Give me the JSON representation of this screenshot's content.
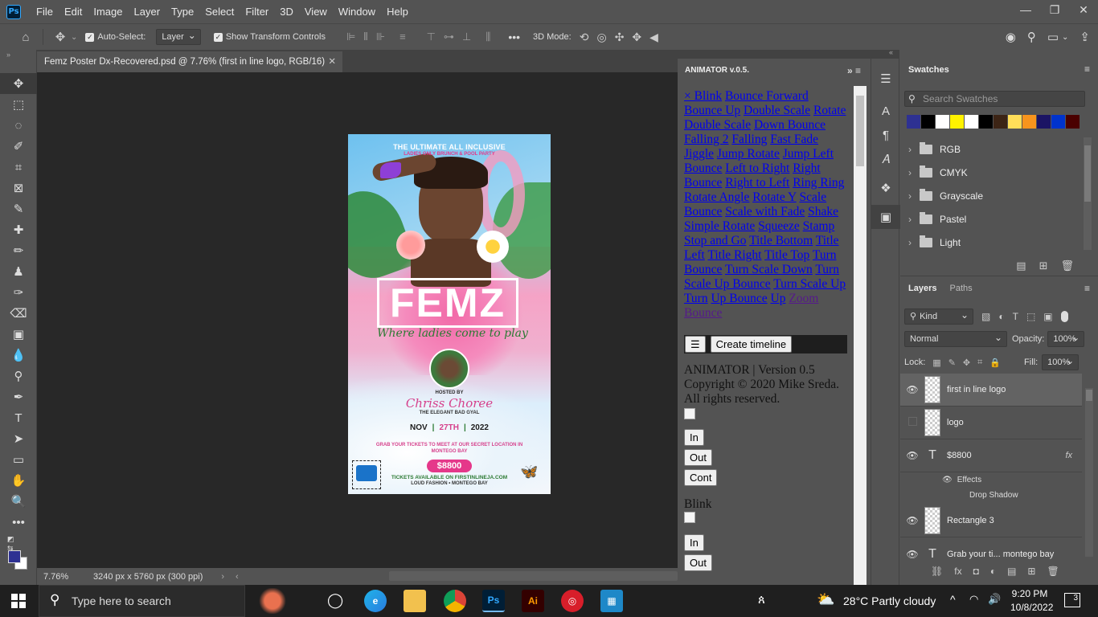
{
  "menubar": {
    "app_icon": "Ps",
    "items": [
      "File",
      "Edit",
      "Image",
      "Layer",
      "Type",
      "Select",
      "Filter",
      "3D",
      "View",
      "Window",
      "Help"
    ]
  },
  "options": {
    "auto_select_label": "Auto-Select:",
    "auto_select_value": "Layer",
    "show_transform_label": "Show Transform Controls",
    "mode_3d_label": "3D Mode:"
  },
  "document": {
    "tab_title": "Femz Poster Dx-Recovered.psd @ 7.76% (first in line logo, RGB/16)",
    "zoom": "7.76%",
    "doc_size": "3240 px x 5760 px (300 ppi)"
  },
  "poster": {
    "headline": "THE ULTIMATE ALL INCLUSIVE",
    "subheadline": "LADIES ONLY BRUNCH & POOL PARTY",
    "brand": "FEMZ",
    "tagline": "Where ladies come to play",
    "hosted_by": "HOSTED BY",
    "host_name": "Chriss Choree",
    "host_title": "THE ELEGANT BAD GYAL",
    "date_month": "NOV",
    "date_day": "27TH",
    "date_year": "2022",
    "tickets_line": "GRAB YOUR TICKETS TO MEET AT OUR SECRET LOCATION IN MONTEGO BAY",
    "price": "$8800",
    "tickets_available": "TICKETS AVAILABLE ON FIRSTINLINEJA.COM",
    "footer": "LOUD FASHION • MONTEGO BAY"
  },
  "animator": {
    "title": "ANIMATOR v.0.5.",
    "links": [
      "× Blink",
      "Bounce Forward",
      "Bounce Up",
      "Double Scale",
      "Rotate",
      "Double Scale",
      "Down Bounce",
      "Falling 2",
      "Falling",
      "Fast Fade",
      "Jiggle",
      "Jump Rotate",
      "Jump Left Bounce",
      "Left to Right",
      "Right Bounce",
      "Right to Left",
      "Ring Ring",
      "Rotate Angle",
      "Rotate Y",
      "Scale Bounce",
      "Scale with Fade",
      "Shake",
      "Simple Rotate",
      "Squeeze",
      "Stamp",
      "Stop and Go",
      "Title Bottom",
      "Title Left",
      "Title Right",
      "Title Top",
      "Turn Bounce",
      "Turn Scale Down",
      "Turn Scale Up Bounce",
      "Turn Scale Up",
      "Turn",
      "Up Bounce",
      "Up"
    ],
    "visited_link": "Zoom Bounce",
    "menu_button": "☰",
    "create_timeline": "Create timeline",
    "version_line": "ANIMATOR | Version 0.5",
    "copyright_line": "Copyright © 2020 Mike Sreda.",
    "rights_line": "All rights reserved.",
    "btn_in": "In",
    "btn_out": "Out",
    "btn_cont": "Cont",
    "blink_label": "Blink",
    "btn_in_2": "In",
    "btn_out_2": "Out"
  },
  "swatches": {
    "title": "Swatches",
    "search_placeholder": "Search Swatches",
    "colors": [
      "#2e3192",
      "#000000",
      "#ffffff",
      "#fff200",
      "#ffffff",
      "#000000",
      "#3c2415",
      "#ffde59",
      "#f7941d",
      "#1b1464",
      "#0033cc",
      "#4a0000"
    ],
    "groups": [
      "RGB",
      "CMYK",
      "Grayscale",
      "Pastel",
      "Light"
    ]
  },
  "layers": {
    "tab_layers": "Layers",
    "tab_paths": "Paths",
    "kind_label": "Kind",
    "blend_mode": "Normal",
    "opacity_label": "Opacity:",
    "opacity_value": "100%",
    "lock_label": "Lock:",
    "fill_label": "Fill:",
    "fill_value": "100%",
    "items": [
      {
        "name": "first in line logo",
        "visible": true,
        "selected": true,
        "type": "smart"
      },
      {
        "name": "logo",
        "visible": false,
        "selected": false,
        "type": "smart"
      },
      {
        "name": "$8800",
        "visible": true,
        "selected": false,
        "type": "text"
      },
      {
        "name": "Effects",
        "visible": true,
        "selected": false,
        "type": "effect"
      },
      {
        "name": "Drop Shadow",
        "visible": false,
        "selected": false,
        "type": "effect-sub"
      },
      {
        "name": "Rectangle 3",
        "visible": true,
        "selected": false,
        "type": "shape"
      },
      {
        "name": "Grab your ti... montego bay",
        "visible": true,
        "selected": false,
        "type": "text"
      }
    ]
  },
  "taskbar": {
    "search_placeholder": "Type here to search",
    "weather": "28°C  Partly cloudy",
    "time": "9:20 PM",
    "date": "10/8/2022",
    "notif_count": "3"
  }
}
